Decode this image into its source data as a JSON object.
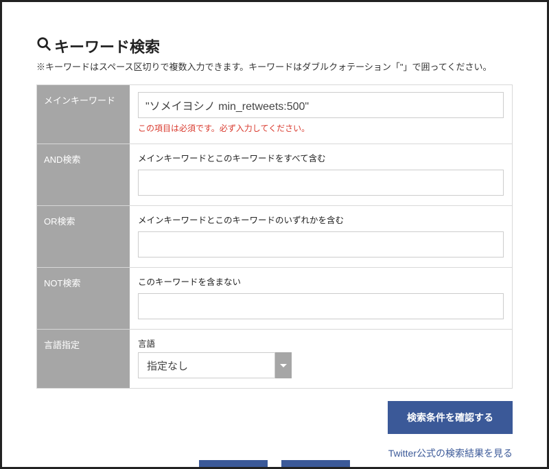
{
  "header": {
    "title": "キーワード検索",
    "subnote": "※キーワードはスペース区切りで複数入力できます。キーワードはダブルクォテーション「\"」で囲ってください。"
  },
  "fields": {
    "main": {
      "label": "メインキーワード",
      "value": "\"ソメイヨシノ min_retweets:500\"",
      "required_note": "この項目は必須です。必ず入力してください。"
    },
    "and": {
      "label": "AND検索",
      "hint": "メインキーワードとこのキーワードをすべて含む",
      "value": ""
    },
    "or": {
      "label": "OR検索",
      "hint": "メインキーワードとこのキーワードのいずれかを含む",
      "value": ""
    },
    "not": {
      "label": "NOT検索",
      "hint": "このキーワードを含まない",
      "value": ""
    },
    "lang": {
      "label": "言語指定",
      "sub_label": "言語",
      "selected": "指定なし"
    }
  },
  "actions": {
    "submit": "検索条件を確認する",
    "twitter_link": "Twitter公式の検索結果を見る"
  }
}
